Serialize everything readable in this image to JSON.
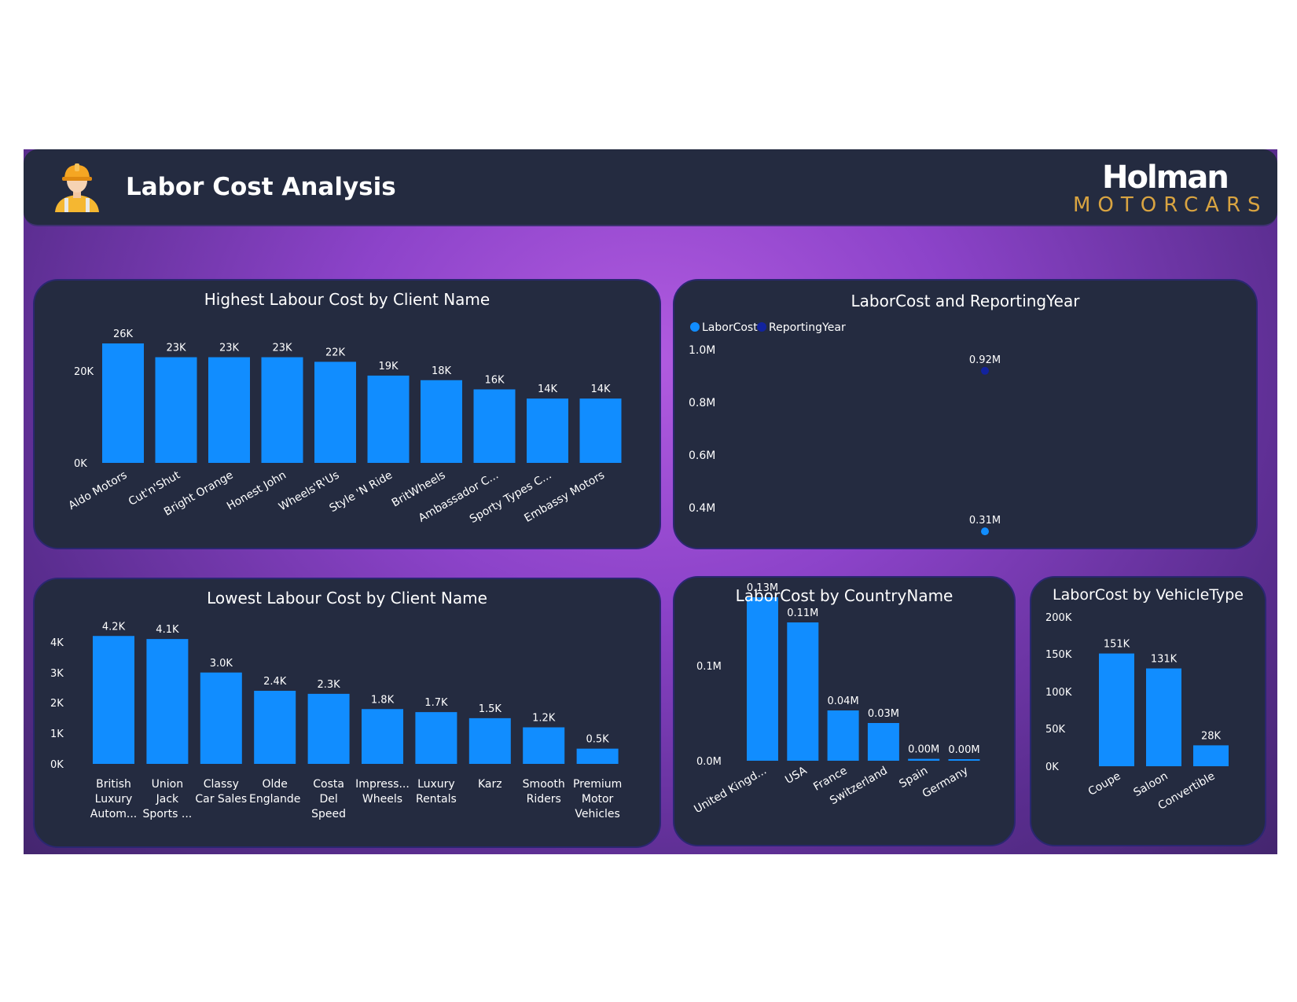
{
  "header": {
    "title": "Labor Cost Analysis",
    "brand_top": "Holman",
    "brand_bottom": "MOTORCARS",
    "icon": "worker-hardhat-icon"
  },
  "colors": {
    "bar": "#118dff",
    "dark_point": "#12239e",
    "panel": "#242b40",
    "text": "#ffffff",
    "accent": "#d9a441"
  },
  "chart_data": [
    {
      "id": "highest",
      "type": "bar",
      "title": "Highest Labour Cost by Client Name",
      "categories": [
        "Aldo Motors",
        "Cut'n'Shut",
        "Bright Orange",
        "Honest John",
        "Wheels'R'Us",
        "Style 'N Ride",
        "BritWheels",
        "Ambassador C...",
        "Sporty Types C...",
        "Embassy Motors"
      ],
      "values": [
        26000,
        23000,
        23000,
        23000,
        22000,
        19000,
        18000,
        16000,
        14000,
        14000
      ],
      "data_labels": [
        "26K",
        "23K",
        "23K",
        "23K",
        "22K",
        "19K",
        "18K",
        "16K",
        "14K",
        "14K"
      ],
      "yticks": [
        "0K",
        "20K"
      ],
      "ylim": [
        0,
        26000
      ]
    },
    {
      "id": "scatter",
      "type": "scatter",
      "title": "LaborCost and ReportingYear",
      "legend": [
        "LaborCost",
        "ReportingYear"
      ],
      "series": [
        {
          "name": "LaborCost",
          "values": [
            310000
          ],
          "data_labels": [
            "0.31M"
          ]
        },
        {
          "name": "ReportingYear",
          "values": [
            920000
          ],
          "data_labels": [
            "0.92M"
          ]
        }
      ],
      "yticks": [
        "0.4M",
        "0.6M",
        "0.8M",
        "1.0M"
      ],
      "ylim": [
        300000,
        1000000
      ]
    },
    {
      "id": "lowest",
      "type": "bar",
      "title": "Lowest Labour Cost by Client Name",
      "categories": [
        [
          "British",
          "Luxury",
          "Autom..."
        ],
        [
          "Union",
          "Jack",
          "Sports ..."
        ],
        [
          "Classy",
          "Car Sales"
        ],
        [
          "Olde",
          "Englande"
        ],
        [
          "Costa",
          "Del",
          "Speed"
        ],
        [
          "Impress...",
          "Wheels"
        ],
        [
          "Luxury",
          "Rentals"
        ],
        [
          "Karz"
        ],
        [
          "Smooth",
          "Riders"
        ],
        [
          "Premium",
          "Motor",
          "Vehicles"
        ]
      ],
      "values": [
        4200,
        4100,
        3000,
        2400,
        2300,
        1800,
        1700,
        1500,
        1200,
        500
      ],
      "data_labels": [
        "4.2K",
        "4.1K",
        "3.0K",
        "2.4K",
        "2.3K",
        "1.8K",
        "1.7K",
        "1.5K",
        "1.2K",
        "0.5K"
      ],
      "yticks": [
        "0K",
        "1K",
        "2K",
        "3K",
        "4K"
      ],
      "ylim": [
        0,
        4000
      ]
    },
    {
      "id": "country",
      "type": "bar",
      "title": "LaborCost by CountryName",
      "categories": [
        "United Kingd...",
        "USA",
        "France",
        "Switzerland",
        "Spain",
        "Germany"
      ],
      "values": [
        130000,
        110000,
        40000,
        30000,
        1500,
        1000
      ],
      "data_labels": [
        "0.13M",
        "0.11M",
        "0.04M",
        "0.03M",
        "0.00M",
        "0.00M"
      ],
      "yticks": [
        "0.0M",
        "0.1M"
      ],
      "ylim": [
        0,
        100000
      ]
    },
    {
      "id": "vehicle",
      "type": "bar",
      "title": "LaborCost by VehicleType",
      "categories": [
        "Coupe",
        "Saloon",
        "Convertible"
      ],
      "values": [
        151000,
        131000,
        28000
      ],
      "data_labels": [
        "151K",
        "131K",
        "28K"
      ],
      "yticks": [
        "0K",
        "50K",
        "100K",
        "150K",
        "200K"
      ],
      "ylim": [
        0,
        200000
      ]
    }
  ]
}
